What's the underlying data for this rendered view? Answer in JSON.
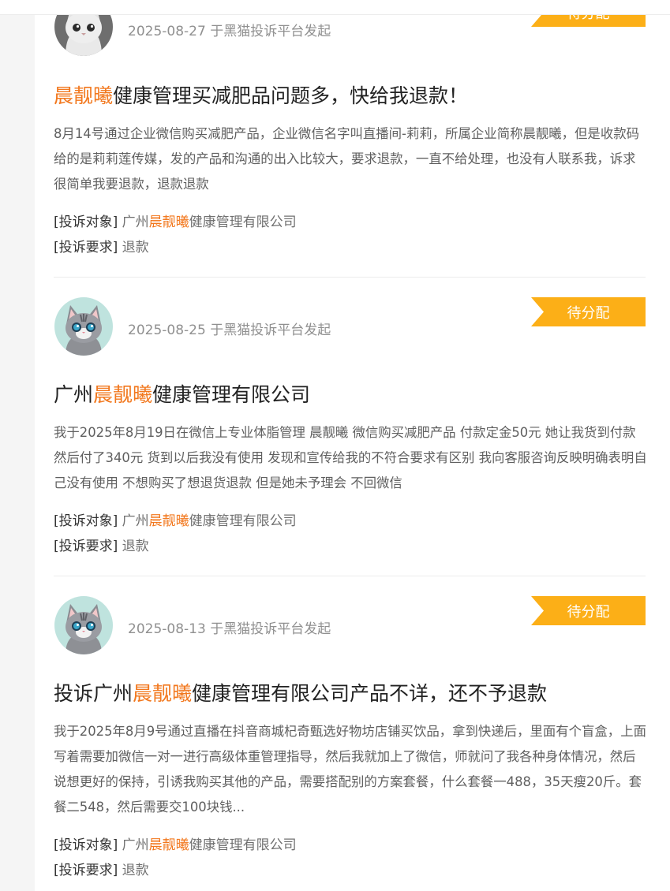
{
  "colors": {
    "highlight": "#f2781e",
    "badge": "#fcaf17",
    "text": "#222222",
    "muted": "#909090"
  },
  "complaints": [
    {
      "avatar": "cat-avatar-icon",
      "date": "2025-08-27 于黑猫投诉平台发起",
      "status": "待分配",
      "title_pre": "",
      "title_hl": "晨靓曦",
      "title_post": "健康管理买减肥品问题多，快给我退款！",
      "desc": "8月14号通过企业微信购买减肥产品，企业微信名字叫直播间-莉莉，所属企业简称晨靓曦，但是收款码给的是莉莉莲传媒，发的产品和沟通的出入比较大，要求退款，一直不给处理，也没有人联系我，诉求很简单我要退款，退款退款",
      "target_label": "[投诉对象]",
      "target_pre": "广州",
      "target_hl": "晨靓曦",
      "target_post": "健康管理有限公司",
      "demand_label": "[投诉要求]",
      "demand": "退款"
    },
    {
      "avatar": "cat-avatar-icon",
      "date": "2025-08-25 于黑猫投诉平台发起",
      "status": "待分配",
      "title_pre": "广州",
      "title_hl": "晨靓曦",
      "title_post": "健康管理有限公司",
      "desc": "我于2025年8月19日在微信上专业体脂管理 晨靓曦 微信购买减肥产品 付款定金50元 她让我货到付款 然后付了340元 货到以后我没有使用 发现和宣传给我的不符合要求有区别 我向客服咨询反映明确表明自己没有使用 不想购买了想退货退款 但是她未予理会 不回微信",
      "target_label": "[投诉对象]",
      "target_pre": "广州",
      "target_hl": "晨靓曦",
      "target_post": "健康管理有限公司",
      "demand_label": "[投诉要求]",
      "demand": "退款"
    },
    {
      "avatar": "cat-avatar-icon",
      "date": "2025-08-13 于黑猫投诉平台发起",
      "status": "待分配",
      "title_pre": "投诉广州",
      "title_hl": "晨靓曦",
      "title_post": "健康管理有限公司产品不详，还不予退款",
      "desc": "我于2025年8月9号通过直播在抖音商城杞奇甄选好物坊店铺买饮品，拿到快递后，里面有个盲盒，上面写着需要加微信一对一进行高级体重管理指导，然后我就加上了微信，师就问了我各种身体情况，然后说想更好的保持，引诱我购买其他的产品，需要搭配别的方案套餐，什么套餐一488，35天瘦20斤。套餐二548，然后需要交100块钱...",
      "target_label": "[投诉对象]",
      "target_pre": "广州",
      "target_hl": "晨靓曦",
      "target_post": "健康管理有限公司",
      "demand_label": "[投诉要求]",
      "demand": "退款"
    }
  ]
}
